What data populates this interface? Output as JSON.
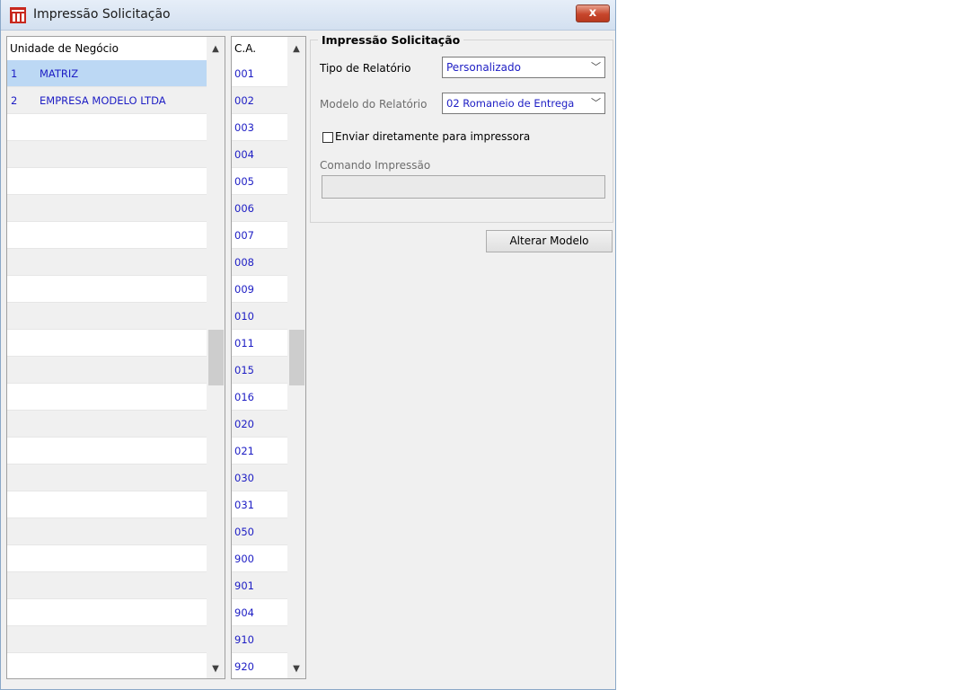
{
  "window": {
    "title": "Impressão Solicitação",
    "close_symbol": "x",
    "logo_icon": "app-logo-icon",
    "accent_color": "#c7462c"
  },
  "units_grid": {
    "header": "Unidade de Negócio",
    "rows": [
      {
        "code": "1",
        "name": "MATRIZ",
        "selected": true
      },
      {
        "code": "2",
        "name": "EMPRESA MODELO LTDA",
        "selected": false
      }
    ],
    "empty_rows": 20
  },
  "ca_grid": {
    "header": "C.A.",
    "rows": [
      "001",
      "002",
      "003",
      "004",
      "005",
      "006",
      "007",
      "008",
      "009",
      "010",
      "011",
      "015",
      "016",
      "020",
      "021",
      "030",
      "031",
      "050",
      "900",
      "901",
      "904",
      "910",
      "920"
    ]
  },
  "panel": {
    "group_title": "Impressão Solicitação",
    "tipo_label": "Tipo de Relatório",
    "tipo_value": "Personalizado",
    "modelo_label": "Modelo do Relatório",
    "modelo_value": "02 Romaneio de Entrega",
    "enviar_label": "Enviar diretamente para impressora",
    "enviar_checked": false,
    "comando_label": "Comando Impressão",
    "comando_value": "",
    "alterar_button": "Alterar Modelo"
  },
  "icons": {
    "dropdown": "chevron-down-icon",
    "scroll_up": "scroll-up-icon",
    "scroll_down": "scroll-down-icon"
  }
}
